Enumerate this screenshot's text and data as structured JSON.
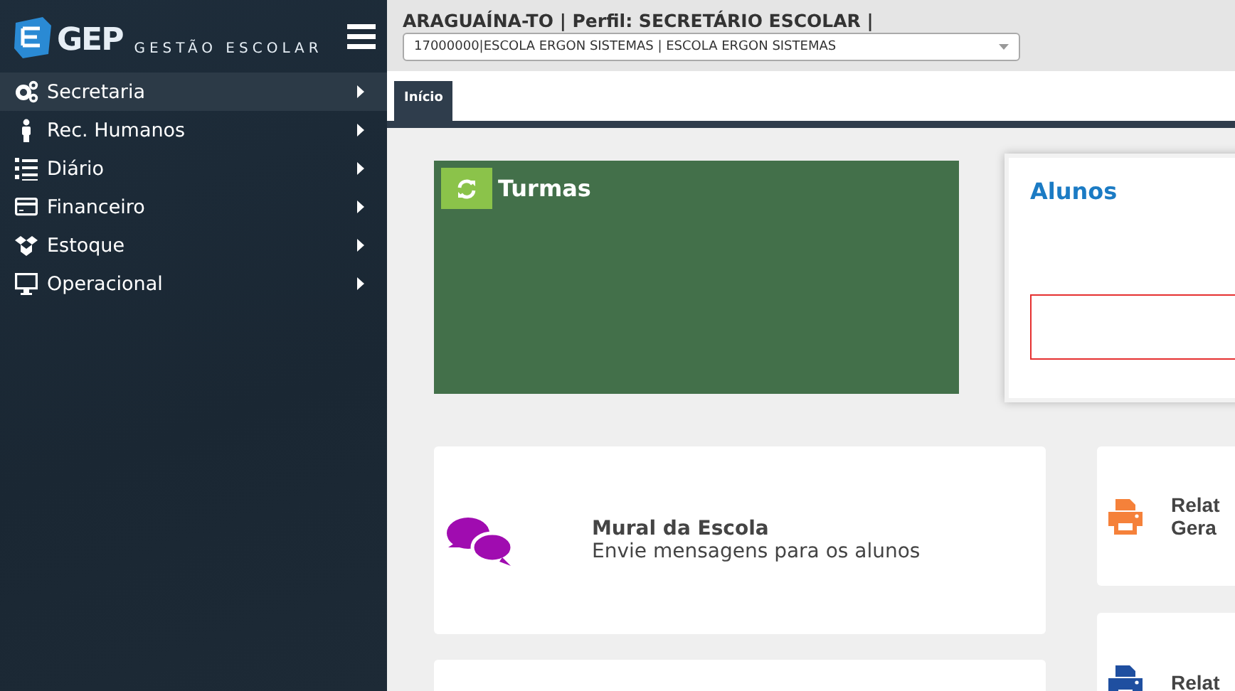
{
  "brand": {
    "logo_text": "GEP",
    "tagline": "GESTÃO ESCOLAR"
  },
  "sidebar": {
    "items": [
      {
        "label": "Secretaria",
        "selected": true
      },
      {
        "label": "Rec. Humanos",
        "selected": false
      },
      {
        "label": "Diário",
        "selected": false
      },
      {
        "label": "Financeiro",
        "selected": false
      },
      {
        "label": "Estoque",
        "selected": false
      },
      {
        "label": "Operacional",
        "selected": false
      }
    ]
  },
  "header": {
    "title": "ARAGUAÍNA-TO | Perfil: SECRETÁRIO ESCOLAR |",
    "school_select": {
      "value": "17000000|ESCOLA ERGON SISTEMAS | ESCOLA ERGON SISTEMAS"
    }
  },
  "tabs": [
    {
      "label": "Início",
      "selected": true
    }
  ],
  "widgets": {
    "turmas": {
      "title": "Turmas"
    },
    "alunos": {
      "title": "Alunos"
    }
  },
  "shortcuts_left": [
    {
      "kind": "chat",
      "title": "Mural da Escola",
      "subtitle": "Envie mensagens para os alunos"
    },
    {
      "kind": "blank"
    }
  ],
  "shortcuts_right": [
    {
      "kind": "report",
      "title": "Relat",
      "subtitle": "Gera",
      "color": "#f5813a"
    },
    {
      "kind": "report",
      "title": "Relat",
      "color": "#1f4fa0"
    }
  ]
}
